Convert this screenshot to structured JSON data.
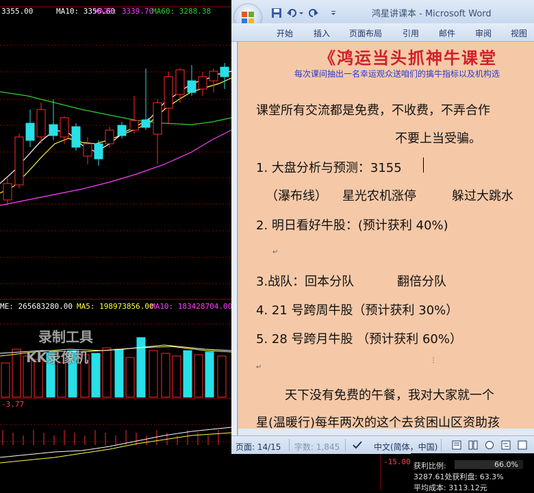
{
  "chart": {
    "price_ma_row": {
      "close": "3355.00",
      "ma10": "MA10: 3356.60",
      "ma20": "MA20: 3339.70",
      "ma60": "MA60: 3288.38"
    },
    "volume_row": {
      "volume": "ME: 265683280.00",
      "ma5": "MA5: 198973856.00",
      "ma10": "MA10: 183428704.00"
    },
    "indicator_value": "-3.77",
    "right_axis_label": "-15.00",
    "colors": {
      "up": "#ff2a2a",
      "down": "#28e0e8",
      "ma_white": "#ffffff",
      "ma_yellow": "#ffff40",
      "ma_green": "#30d030",
      "ma_magenta": "#ff40ff"
    }
  },
  "word": {
    "title": "鸿星讲课本 - Microsoft Word",
    "tabs": [
      "开始",
      "插入",
      "页面布局",
      "引用",
      "邮件",
      "审阅",
      "视图"
    ],
    "doc": {
      "heading": "《鸿运当头抓神牛课堂",
      "subline": "每次课间抽出一名幸运观众送咱们的擒牛指标以及机构选",
      "line1": "课堂所有交流都是免费，不收费，不弄合作",
      "line2": "不要上当受骗。",
      "line3": "1. 大盘分析与预测：3155",
      "line4a": "（瀑布线）",
      "line4b": "星光农机涨停",
      "line4c": "躲过大跳水",
      "line5": "2. 明日看好牛股：(预计获利 40%)",
      "line6a": "3.战队：回本分队",
      "line6b": "翻倍分队",
      "line7": "4.    21 号跨周牛股（预计获利 30%）",
      "line8": "5.    28 号跨月牛股  （预计获利 60%）",
      "line9": "天下没有免费的午餐，我对大家就一个",
      "line10": "星(温暖行)每年两次的这个去贫困山区资助孩"
    },
    "status": {
      "page": "页面: 14/15",
      "words": "字数: 1,845",
      "lang": "中文(简体，中国)"
    }
  },
  "info_panel": {
    "ratio_label": "获利比例:",
    "ratio_value": "66.0%",
    "line2": "3287.61处获利盘: 63.3%",
    "line3": "平均成本: 3113.12元"
  },
  "watermark": {
    "line1": "录制工具",
    "line2": "KK录像机"
  }
}
